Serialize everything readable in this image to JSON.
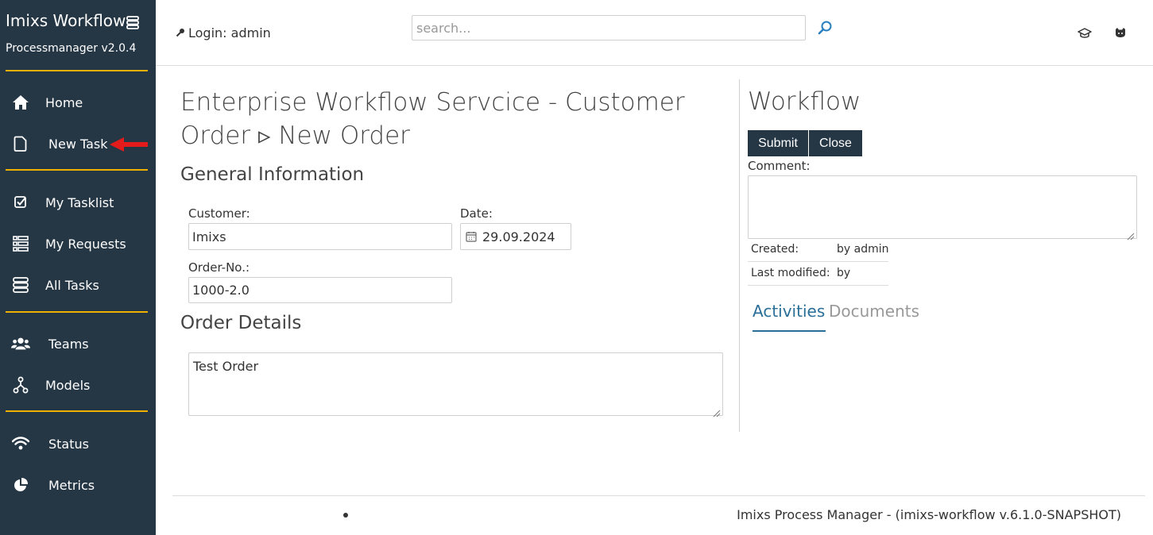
{
  "sidebar": {
    "brand_title": "Imixs Workflow",
    "brand_version": "Processmanager v2.0.4",
    "items": [
      {
        "label": "Home",
        "icon": "home-icon"
      },
      {
        "label": "New Task",
        "icon": "file-icon"
      },
      {
        "label": "My Tasklist",
        "icon": "checkbox-icon"
      },
      {
        "label": "My Requests",
        "icon": "list-icon"
      },
      {
        "label": "All Tasks",
        "icon": "stack-icon"
      },
      {
        "label": "Teams",
        "icon": "users-icon"
      },
      {
        "label": "Models",
        "icon": "sitemap-icon"
      },
      {
        "label": "Status",
        "icon": "wifi-icon"
      },
      {
        "label": "Metrics",
        "icon": "pie-chart-icon"
      }
    ],
    "accent_color": "#f0b000",
    "background_color": "#253645"
  },
  "header": {
    "login_text": "Login: admin",
    "search_placeholder": "search...",
    "search_value": ""
  },
  "main": {
    "title": "Enterprise Workflow Servcice - Customer Order ▹ New Order",
    "general_section": "General Information",
    "customer_label": "Customer:",
    "customer_value": "Imixs",
    "date_label": "Date:",
    "date_value": "29.09.2024",
    "order_no_label": "Order-No.:",
    "order_no_value": "1000-2.0",
    "details_section": "Order Details",
    "details_value": "Test Order"
  },
  "workflow": {
    "title": "Workflow",
    "submit_label": "Submit",
    "close_label": "Close",
    "comment_label": "Comment:",
    "comment_value": "",
    "created_label": "Created:",
    "created_value": "by admin",
    "modified_label": "Last modified:",
    "modified_value": "by",
    "tabs": [
      {
        "label": "Activities",
        "active": true
      },
      {
        "label": "Documents",
        "active": false
      }
    ],
    "active_tab_color": "#2a6f97"
  },
  "footer": {
    "text": "Imixs Process Manager - (imixs-workflow v.6.1.0-SNAPSHOT)"
  }
}
